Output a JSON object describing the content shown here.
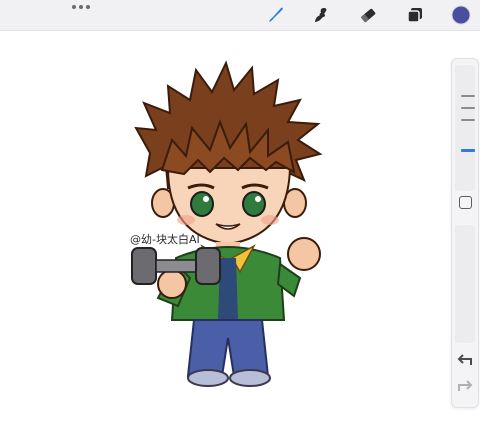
{
  "toolbar": {
    "menu_icon": "more-dots-icon",
    "tools": [
      {
        "name": "brush",
        "icon": "brush-icon",
        "active": true
      },
      {
        "name": "smudge",
        "icon": "smudge-icon",
        "active": false
      },
      {
        "name": "eraser",
        "icon": "eraser-icon",
        "active": false
      },
      {
        "name": "layers",
        "icon": "layers-icon",
        "active": false
      },
      {
        "name": "color",
        "icon": "color-swatch-icon",
        "active": false
      }
    ],
    "active_color": "#4a4ea0",
    "accent": "#2f79e6"
  },
  "sidebar": {
    "brush_size_level": 0.85,
    "opacity_level": 0.0,
    "undo_icon": "undo-icon",
    "redo_icon": "redo-icon",
    "modify_icon": "modify-square-icon"
  },
  "artwork": {
    "signature_text": "@幼-块太白AI"
  }
}
